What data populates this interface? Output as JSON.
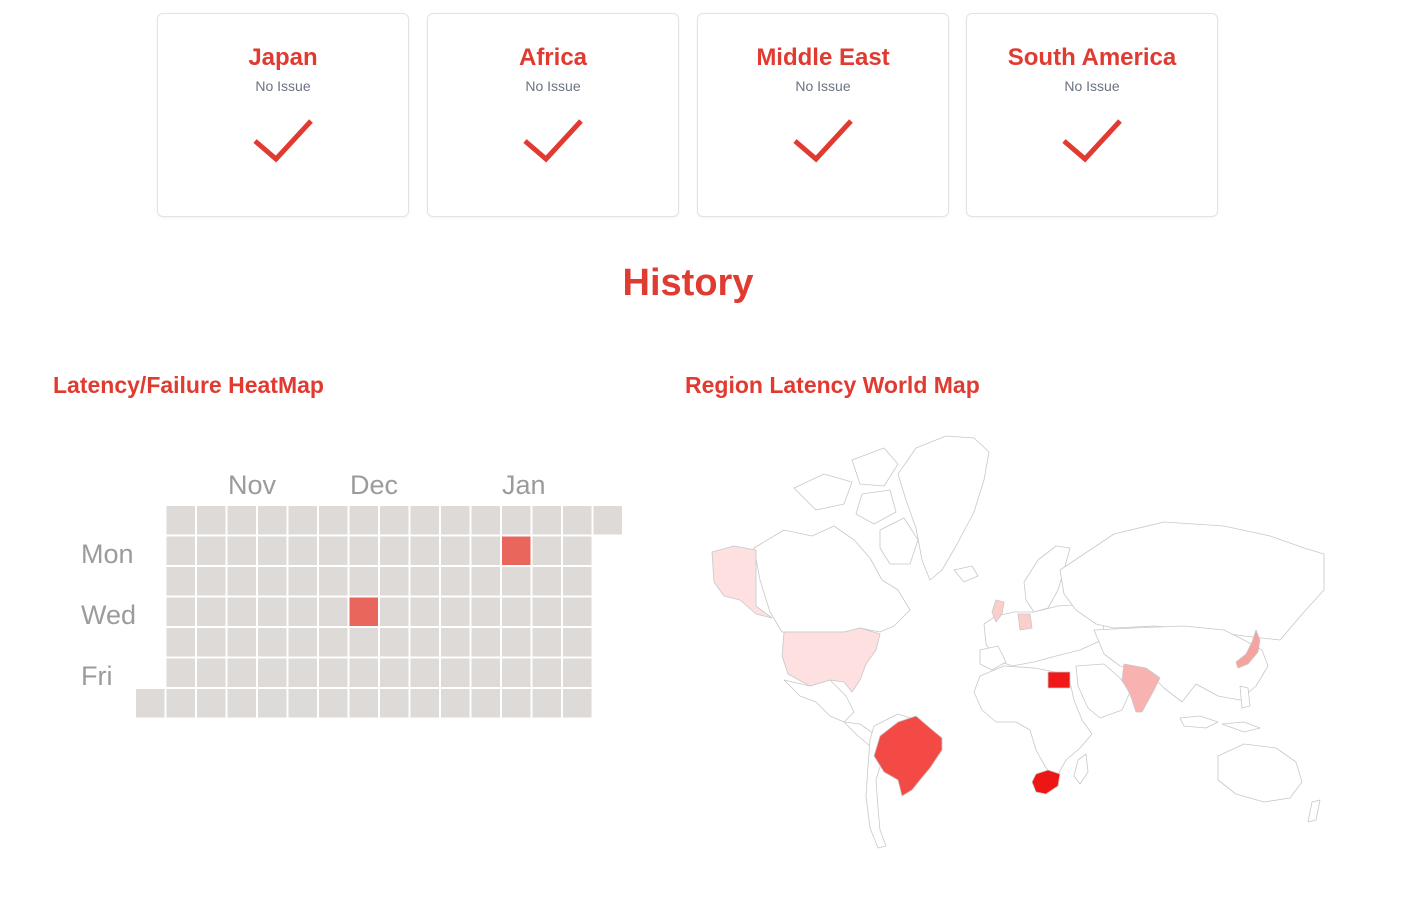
{
  "regions": [
    {
      "name": "Japan",
      "status": "No Issue"
    },
    {
      "name": "Africa",
      "status": "No Issue"
    },
    {
      "name": "Middle East",
      "status": "No Issue"
    },
    {
      "name": "South America",
      "status": "No Issue"
    }
  ],
  "history": {
    "title": "History",
    "heatmap_title": "Latency/Failure HeatMap",
    "worldmap_title": "Region Latency World Map"
  },
  "heatmap": {
    "month_labels": [
      "Nov",
      "Dec",
      "Jan"
    ],
    "day_labels": [
      "Mon",
      "Wed",
      "Fri"
    ],
    "highlighted": [
      {
        "week": 12,
        "day": 1
      },
      {
        "week": 7,
        "day": 3
      }
    ],
    "colors": {
      "empty": "#dedad7",
      "filled": "#e8665c"
    }
  },
  "worldmap": {
    "highlighted_countries": [
      {
        "name": "Brazil",
        "color": "#f44a46"
      },
      {
        "name": "South Africa",
        "color": "#ee1515"
      },
      {
        "name": "Egypt",
        "color": "#f01818"
      },
      {
        "name": "India",
        "color": "#f8b3b0"
      },
      {
        "name": "Japan",
        "color": "#f6a3a0"
      },
      {
        "name": "United States",
        "color": "#fde0df"
      },
      {
        "name": "Alaska",
        "color": "#fde0df"
      },
      {
        "name": "United Kingdom",
        "color": "#fbcdcb"
      },
      {
        "name": "Germany",
        "color": "#fbcdcb"
      }
    ]
  },
  "colors": {
    "accent": "#e03a31",
    "muted": "#6b7280",
    "card_border": "#e3e3e3"
  }
}
